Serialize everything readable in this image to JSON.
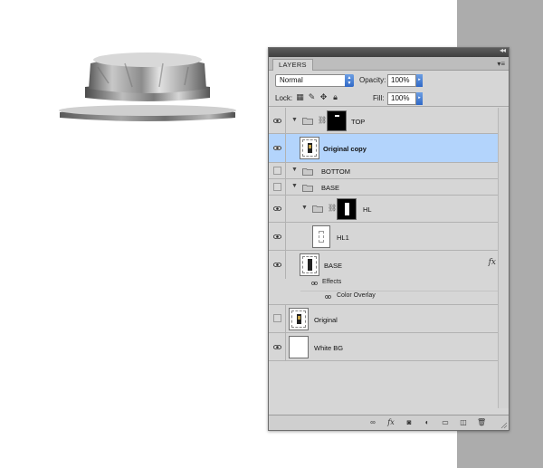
{
  "canvas": {
    "background": "#ffffff",
    "side_strip_color": "#acacac",
    "object": "metal-cap"
  },
  "panel": {
    "tab": "LAYERS",
    "blend_mode": "Normal",
    "opacity_label": "Opacity:",
    "opacity_value": "100%",
    "lock_label": "Lock:",
    "fill_label": "Fill:",
    "fill_value": "100%",
    "lock_icons": [
      "lock-transparent-icon",
      "lock-image-icon",
      "lock-position-icon",
      "lock-all-icon"
    ],
    "selection_color": "#b3d4fc"
  },
  "layers": [
    {
      "name": "TOP",
      "type": "group",
      "visible": true,
      "expanded": true,
      "indent": 0,
      "has_mask": true
    },
    {
      "name": "Original copy",
      "type": "layer",
      "visible": true,
      "indent": 1,
      "selected": true
    },
    {
      "name": "BOTTOM",
      "type": "group",
      "visible": false,
      "expanded": true,
      "indent": 0
    },
    {
      "name": "BASE",
      "type": "group",
      "visible": false,
      "expanded": true,
      "indent": 0
    },
    {
      "name": "HL",
      "type": "group",
      "visible": true,
      "expanded": true,
      "indent": 1,
      "has_mask": true
    },
    {
      "name": "HL1",
      "type": "layer",
      "visible": true,
      "indent": 2
    },
    {
      "name": "BASE",
      "type": "layer",
      "visible": true,
      "indent": 1,
      "fx": "fx",
      "effects_label": "Effects",
      "effects": [
        "Color Overlay"
      ]
    },
    {
      "name": "Original",
      "type": "layer",
      "visible": false,
      "indent": 0
    },
    {
      "name": "White BG",
      "type": "layer",
      "visible": true,
      "indent": 0
    }
  ],
  "bottom_icons": [
    "link-layers-icon",
    "fx-icon",
    "add-mask-icon",
    "adjustment-layer-icon",
    "new-group-icon",
    "new-layer-icon",
    "trash-icon"
  ]
}
